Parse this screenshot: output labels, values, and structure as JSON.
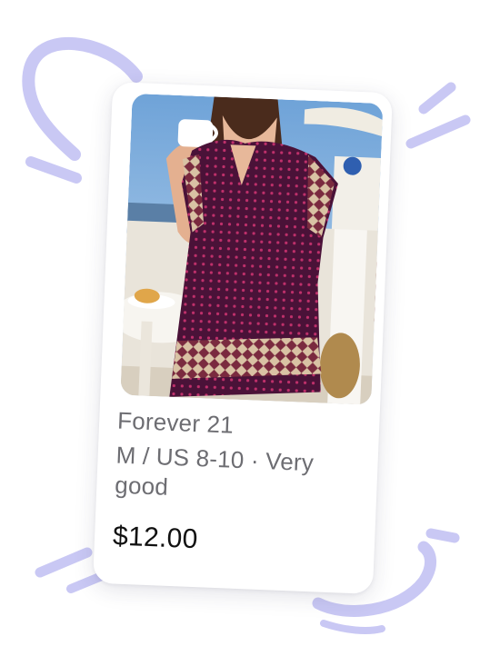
{
  "listing": {
    "brand": "Forever 21",
    "size_condition": "M / US 8-10 · Very good",
    "price": "$12.00",
    "image_subject": "woman in a purple printed boho dress holding a coffee cup at a cafe table"
  },
  "colors": {
    "accent": "#c9c8f4",
    "card_background": "#ffffff",
    "text_secondary": "#6d6d72",
    "text_primary": "#111111"
  }
}
